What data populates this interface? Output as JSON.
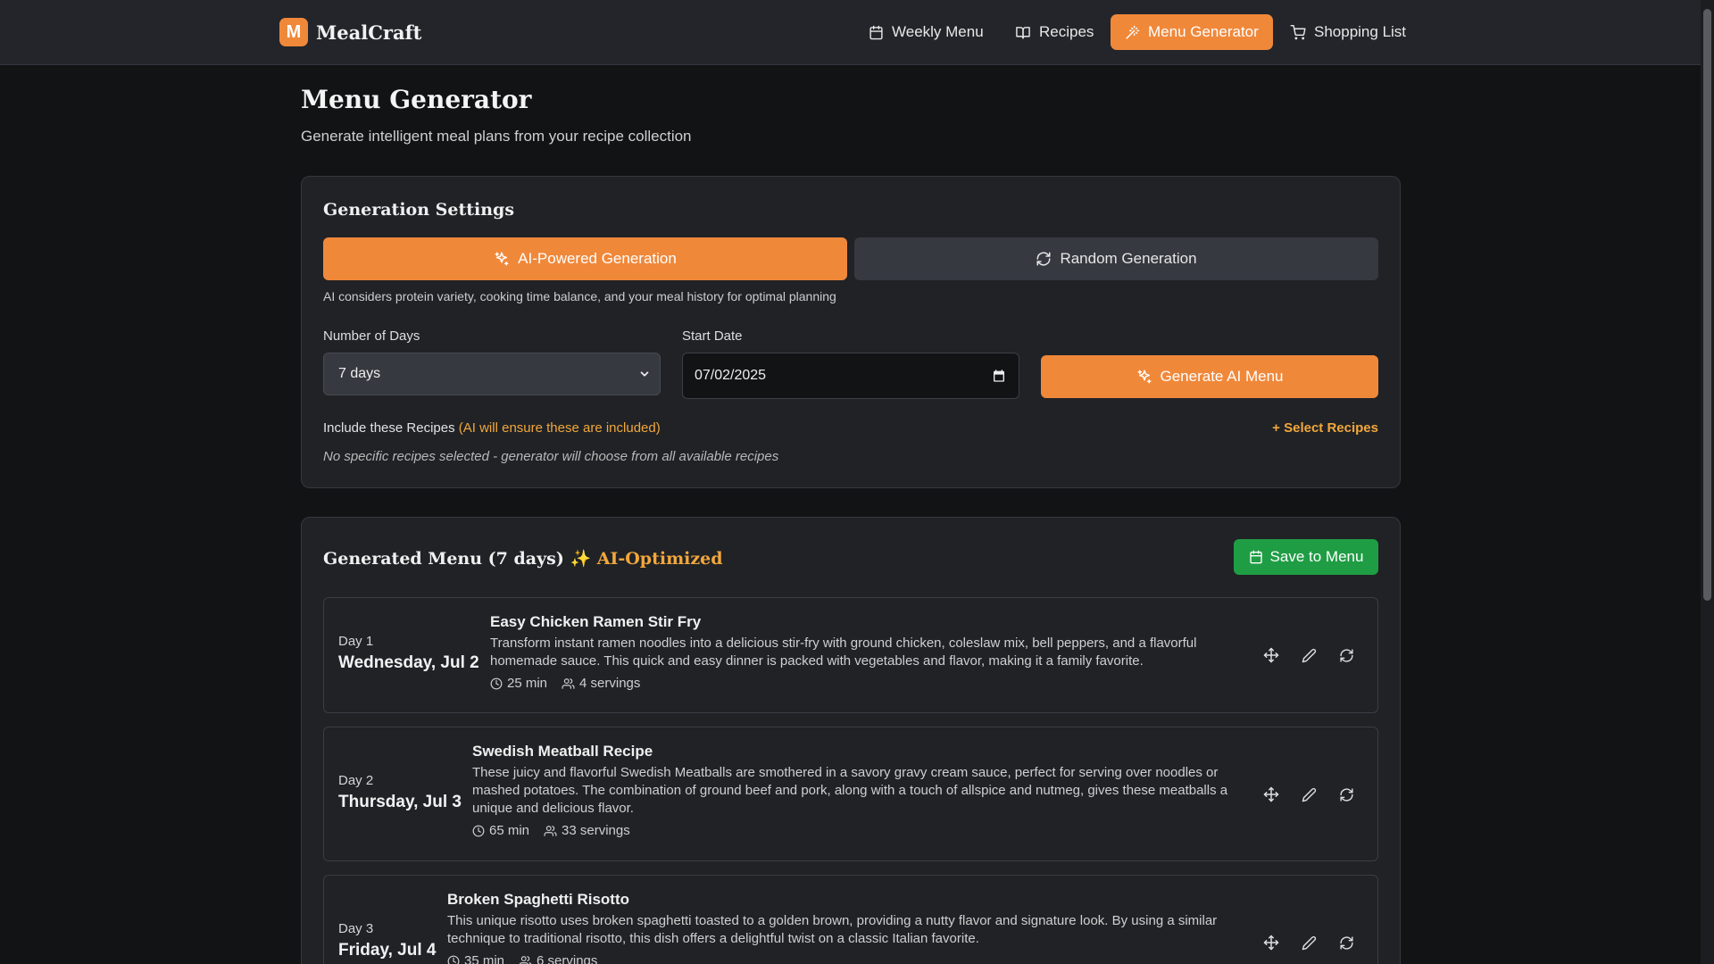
{
  "brand": {
    "logo_letter": "M",
    "name": "MealCraft"
  },
  "nav": {
    "items": [
      {
        "label": "Weekly Menu",
        "icon": "calendar-icon",
        "active": false
      },
      {
        "label": "Recipes",
        "icon": "book-icon",
        "active": false
      },
      {
        "label": "Menu Generator",
        "icon": "magic-wand-icon",
        "active": true
      },
      {
        "label": "Shopping List",
        "icon": "cart-icon",
        "active": false
      }
    ]
  },
  "header": {
    "title": "Menu Generator",
    "subtitle": "Generate intelligent meal plans from your recipe collection"
  },
  "settings": {
    "heading": "Generation Settings",
    "ai_mode_label": "AI-Powered Generation",
    "random_mode_label": "Random Generation",
    "ai_description": "AI considers protein variety, cooking time balance, and your meal history for optimal planning",
    "days_label": "Number of Days",
    "days_value": "7 days",
    "start_date_label": "Start Date",
    "start_date_value": "07/02/2025",
    "generate_button": "Generate AI Menu",
    "include_label": "Include these Recipes",
    "include_hint": "(AI will ensure these are included)",
    "select_recipes_link": "+ Select Recipes",
    "no_recipes_text": "No specific recipes selected - generator will choose from all available recipes"
  },
  "menu": {
    "heading": "Generated Menu (7 days)",
    "ai_badge": "✨ AI-Optimized",
    "save_button": "Save to Menu",
    "days": [
      {
        "day": "Day 1",
        "date": "Wednesday, Jul 2",
        "title": "Easy Chicken Ramen Stir Fry",
        "description": "Transform instant ramen noodles into a delicious stir-fry with ground chicken, coleslaw mix, bell peppers, and a flavorful homemade sauce. This quick and easy dinner is packed with vegetables and flavor, making it a family favorite.",
        "time": "25 min",
        "servings": "4 servings"
      },
      {
        "day": "Day 2",
        "date": "Thursday, Jul 3",
        "title": "Swedish Meatball Recipe",
        "description": "These juicy and flavorful Swedish Meatballs are smothered in a savory gravy cream sauce, perfect for serving over noodles or mashed potatoes. The combination of ground beef and pork, along with a touch of allspice and nutmeg, gives these meatballs a unique and delicious flavor.",
        "time": "65 min",
        "servings": "33 servings"
      },
      {
        "day": "Day 3",
        "date": "Friday, Jul 4",
        "title": "Broken Spaghetti Risotto",
        "description": "This unique risotto uses broken spaghetti toasted to a golden brown, providing a nutty flavor and signature look. By using a similar technique to traditional risotto, this dish offers a delightful twist on a classic Italian favorite.",
        "time": "35 min",
        "servings": "6 servings"
      }
    ]
  },
  "colors": {
    "accent": "#f0883a",
    "success": "#1f9d44",
    "highlight": "#f2a73c",
    "background": "#121315",
    "surface": "#202226"
  }
}
